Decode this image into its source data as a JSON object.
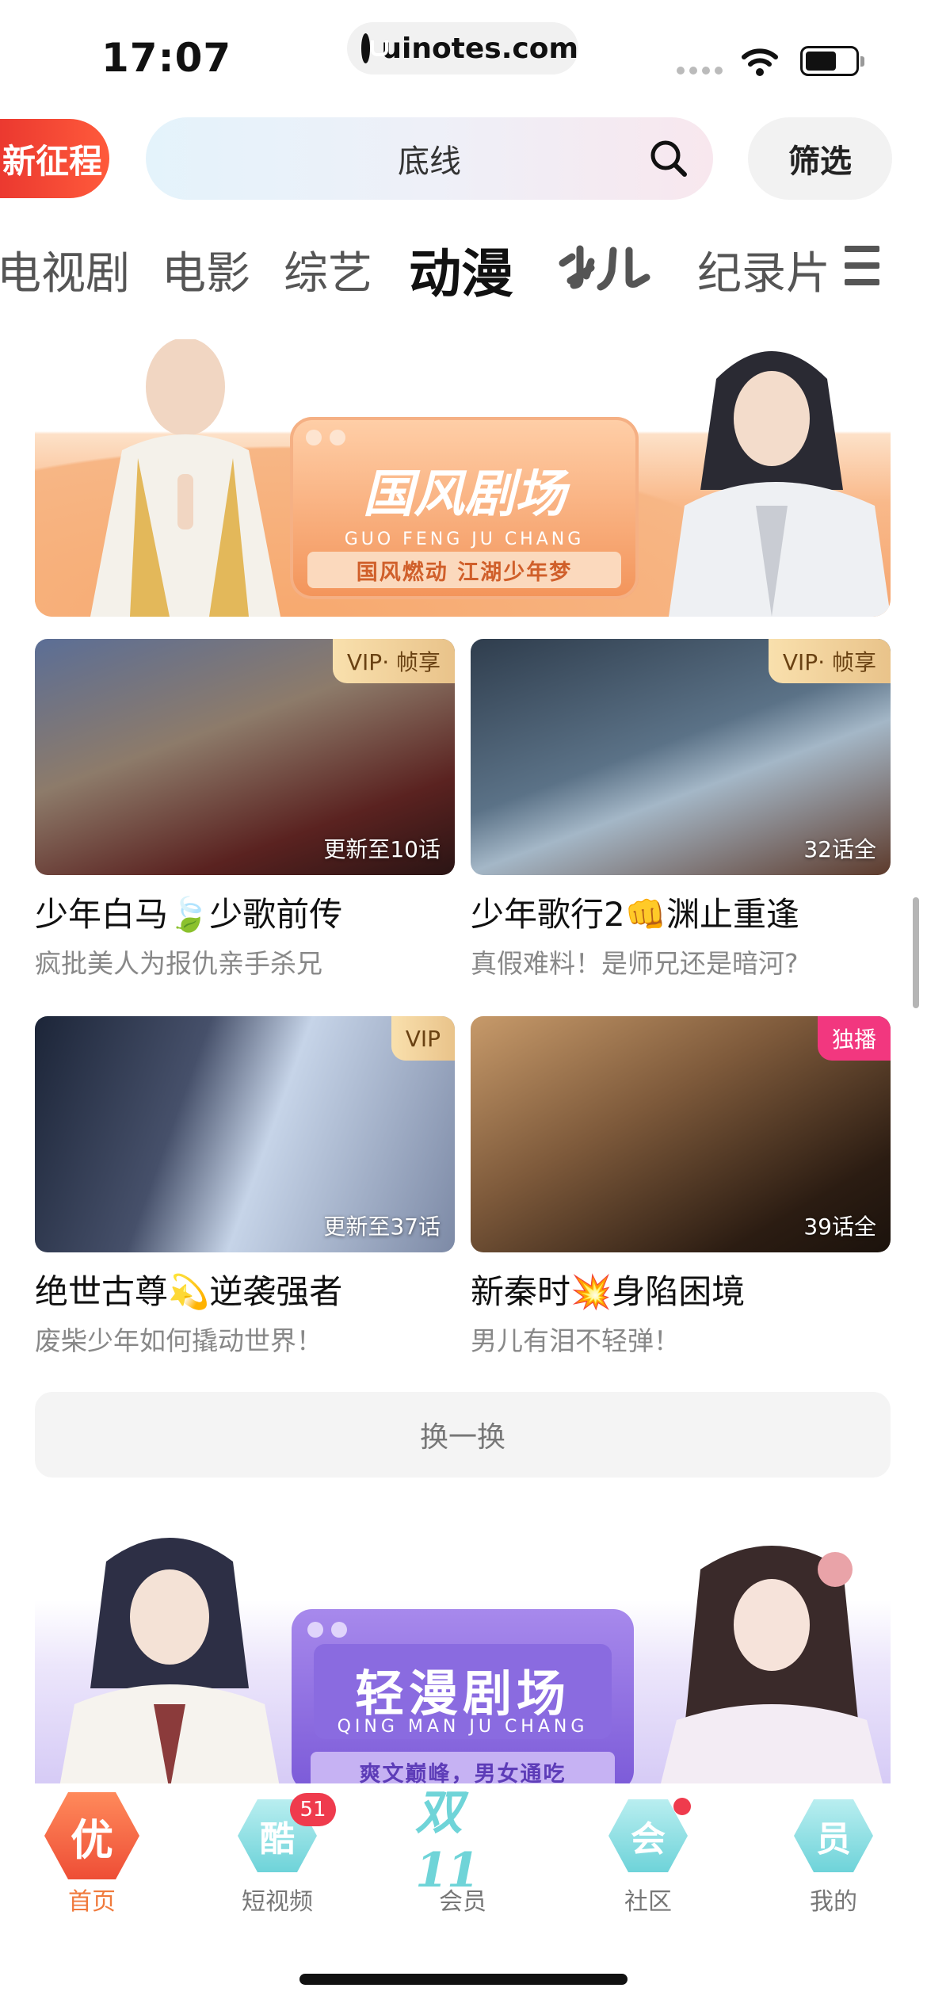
{
  "status_bar": {
    "time": "17:07",
    "url": "uinotes.com"
  },
  "header": {
    "promo_tag": "新征程",
    "search_query": "底线",
    "filter_label": "筛选"
  },
  "tabs": [
    {
      "label": "电视剧"
    },
    {
      "label": "电影"
    },
    {
      "label": "综艺"
    },
    {
      "label": "动漫",
      "active": true
    },
    {
      "label": "少儿"
    },
    {
      "label": "纪录片"
    }
  ],
  "banner_top": {
    "title": "国风剧场",
    "pinyin": "GUO FENG JU CHANG",
    "slogan": "国风燃动 江湖少年梦"
  },
  "cards": [
    {
      "badge": "VIP· 帧享",
      "badge_type": "vip",
      "episodes": "更新至10话",
      "title": "少年白马🍃少歌前传",
      "subtitle": "疯批美人为报仇亲手杀兄"
    },
    {
      "badge": "VIP· 帧享",
      "badge_type": "vip",
      "episodes": "32话全",
      "title": "少年歌行2👊渊止重逢",
      "subtitle": "真假难料！是师兄还是暗河?"
    },
    {
      "badge": "VIP",
      "badge_type": "vip",
      "episodes": "更新至37话",
      "title": "绝世古尊💫逆袭强者",
      "subtitle": "废柴少年如何撬动世界！"
    },
    {
      "badge": "独播",
      "badge_type": "exclusive",
      "episodes": "39话全",
      "title": "新秦时💥身陷困境",
      "subtitle": "男儿有泪不轻弹！"
    }
  ],
  "refresh_label": "换一换",
  "banner_bottom": {
    "title": "轻漫剧场",
    "pinyin": "QING MAN JU CHANG",
    "slogan": "爽文巅峰，男女通吃"
  },
  "bottom_nav": [
    {
      "glyph": "优",
      "label": "首页",
      "active": true
    },
    {
      "glyph": "酷",
      "label": "短视频",
      "badge": "51"
    },
    {
      "glyph": "双11",
      "label": "会员"
    },
    {
      "glyph": "会",
      "label": "社区",
      "dot": true
    },
    {
      "glyph": "员",
      "label": "我的"
    }
  ],
  "colors": {
    "accent": "#f07a3c",
    "badge_red": "#ef3b4d",
    "vip_gold": "#e9c38a",
    "exclusive_pink": "#f2377f"
  }
}
